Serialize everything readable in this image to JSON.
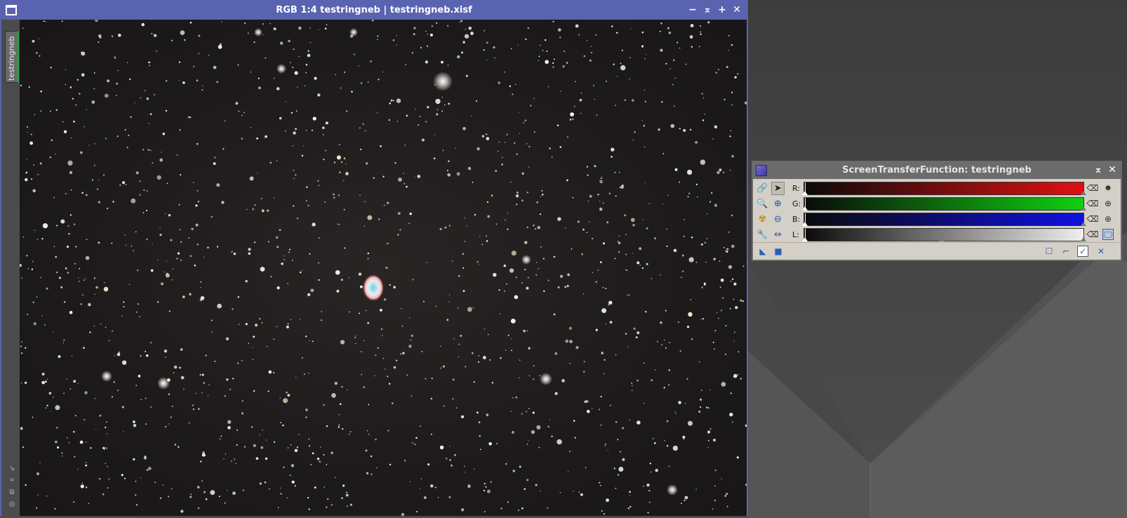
{
  "image_window": {
    "title": "RGB 1:4 testringneb | testringneb.xisf",
    "side_tab": "testringneb",
    "buttons": {
      "minimize": "−",
      "shade": "⌅",
      "maximize": "+",
      "close": "✕"
    }
  },
  "stf": {
    "title": "ScreenTransferFunction: testringneb",
    "buttons": {
      "shade": "⌅",
      "close": "✕"
    },
    "channels": [
      {
        "label": "R:"
      },
      {
        "label": "G:"
      },
      {
        "label": "B:"
      },
      {
        "label": "L:"
      }
    ],
    "colors": {
      "red": "#e01010",
      "green": "#10d010",
      "blue": "#1010e0"
    }
  }
}
